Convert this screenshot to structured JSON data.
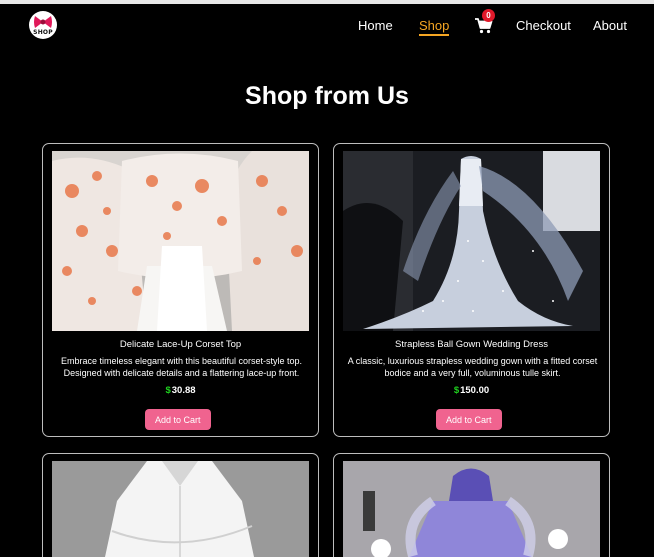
{
  "logo": {
    "text": "SHOP"
  },
  "nav": {
    "home": "Home",
    "shop": "Shop",
    "checkout": "Checkout",
    "about": "About",
    "cart_count": "0"
  },
  "page": {
    "title": "Shop from Us"
  },
  "products": [
    {
      "name": "Delicate Lace-Up Corset Top",
      "description": "Embrace timeless elegant with this beautiful corset-style top. Designed with delicate details and a flattering lace-up front.",
      "currency": "$",
      "price": "30.88",
      "button": "Add to Cart"
    },
    {
      "name": "Strapless Ball Gown Wedding Dress",
      "description": "A classic, luxurious strapless wedding gown with a fitted corset bodice and a very full, voluminous tulle skirt.",
      "currency": "$",
      "price": "150.00",
      "button": "Add to Cart"
    },
    {},
    {}
  ],
  "colors": {
    "background": "#000000",
    "accent_active_nav": "#f5a623",
    "button": "#f0638f",
    "price_currency": "#1fd11f",
    "badge": "#e0192a"
  },
  "icons": [
    "logo-icon",
    "cart-icon"
  ]
}
